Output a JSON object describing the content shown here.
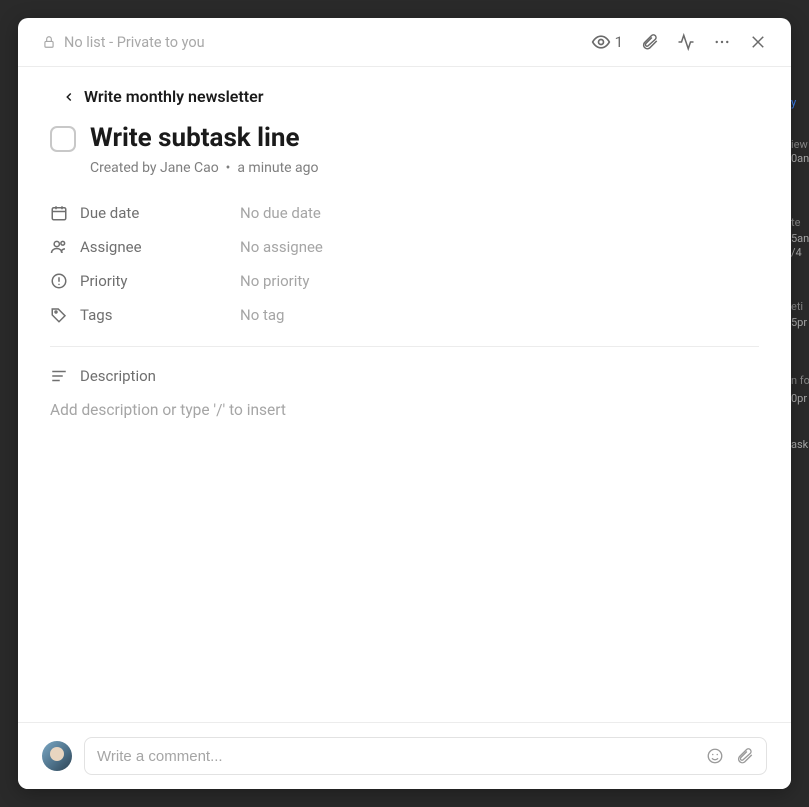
{
  "header": {
    "list_label": "No list - Private to you",
    "watch_count": "1"
  },
  "breadcrumb": {
    "parent": "Write monthly newsletter"
  },
  "task": {
    "title": "Write subtask line",
    "created_by": "Created by Jane Cao",
    "separator": "•",
    "created_time": "a minute ago"
  },
  "fields": {
    "due_date": {
      "label": "Due date",
      "value": "No due date"
    },
    "assignee": {
      "label": "Assignee",
      "value": "No assignee"
    },
    "priority": {
      "label": "Priority",
      "value": "No priority"
    },
    "tags": {
      "label": "Tags",
      "value": "No tag"
    }
  },
  "description": {
    "label": "Description",
    "placeholder": "Add description or type '/' to insert"
  },
  "comment": {
    "placeholder": "Write a comment..."
  }
}
